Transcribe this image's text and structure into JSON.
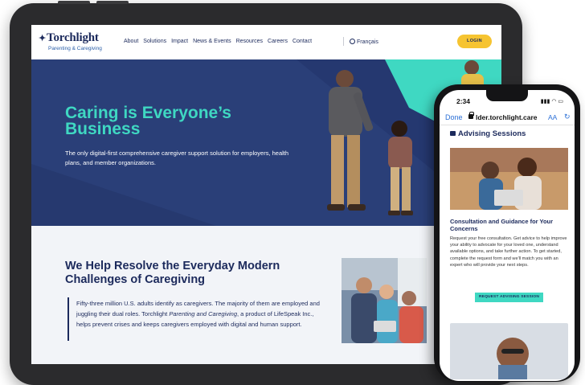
{
  "site": {
    "logo": "Torchlight",
    "logo_sub": "Parenting & Caregiving",
    "nav": [
      "About",
      "Solutions",
      "Impact",
      "News & Events",
      "Resources",
      "Careers",
      "Contact"
    ],
    "language": "Français",
    "login": "LOGIN"
  },
  "hero": {
    "title": "Caring is Everyone’s Business",
    "subtitle": "The only digital-first comprehensive caregiver support solution for employers, health plans, and member organizations."
  },
  "section2": {
    "title": "We Help Resolve the Everyday Modern Challenges of Caregiving",
    "body_1": "Fifty-three million U.S. adults identify as caregivers. The majority of them are employed and juggling their dual roles. Torchlight ",
    "body_italic": "Parenting and Caregiving",
    "body_2": ", a product of LifeSpeak Inc., helps prevent crises and keeps caregivers employed with digital and human support."
  },
  "phone": {
    "time": "2:34",
    "done": "Done",
    "url": "lder.torchlight.care",
    "aa": "AA",
    "page_title": "Advising Sessions",
    "heading": "Consultation and Guidance for Your Concerns",
    "body": "Request your free consultation. Get advice to help improve your ability to advocate for your loved one, understand available options, and take further action. To get started, complete the request form and we'll match you with an expert who will provide your next steps.",
    "button": "REQUEST ADVISING SESSION"
  },
  "colors": {
    "navy": "#1c2a5c",
    "hero_bg": "#2a3f78",
    "teal": "#3fd8c2",
    "yellow": "#f6c431",
    "link_blue": "#2a6fd6"
  }
}
